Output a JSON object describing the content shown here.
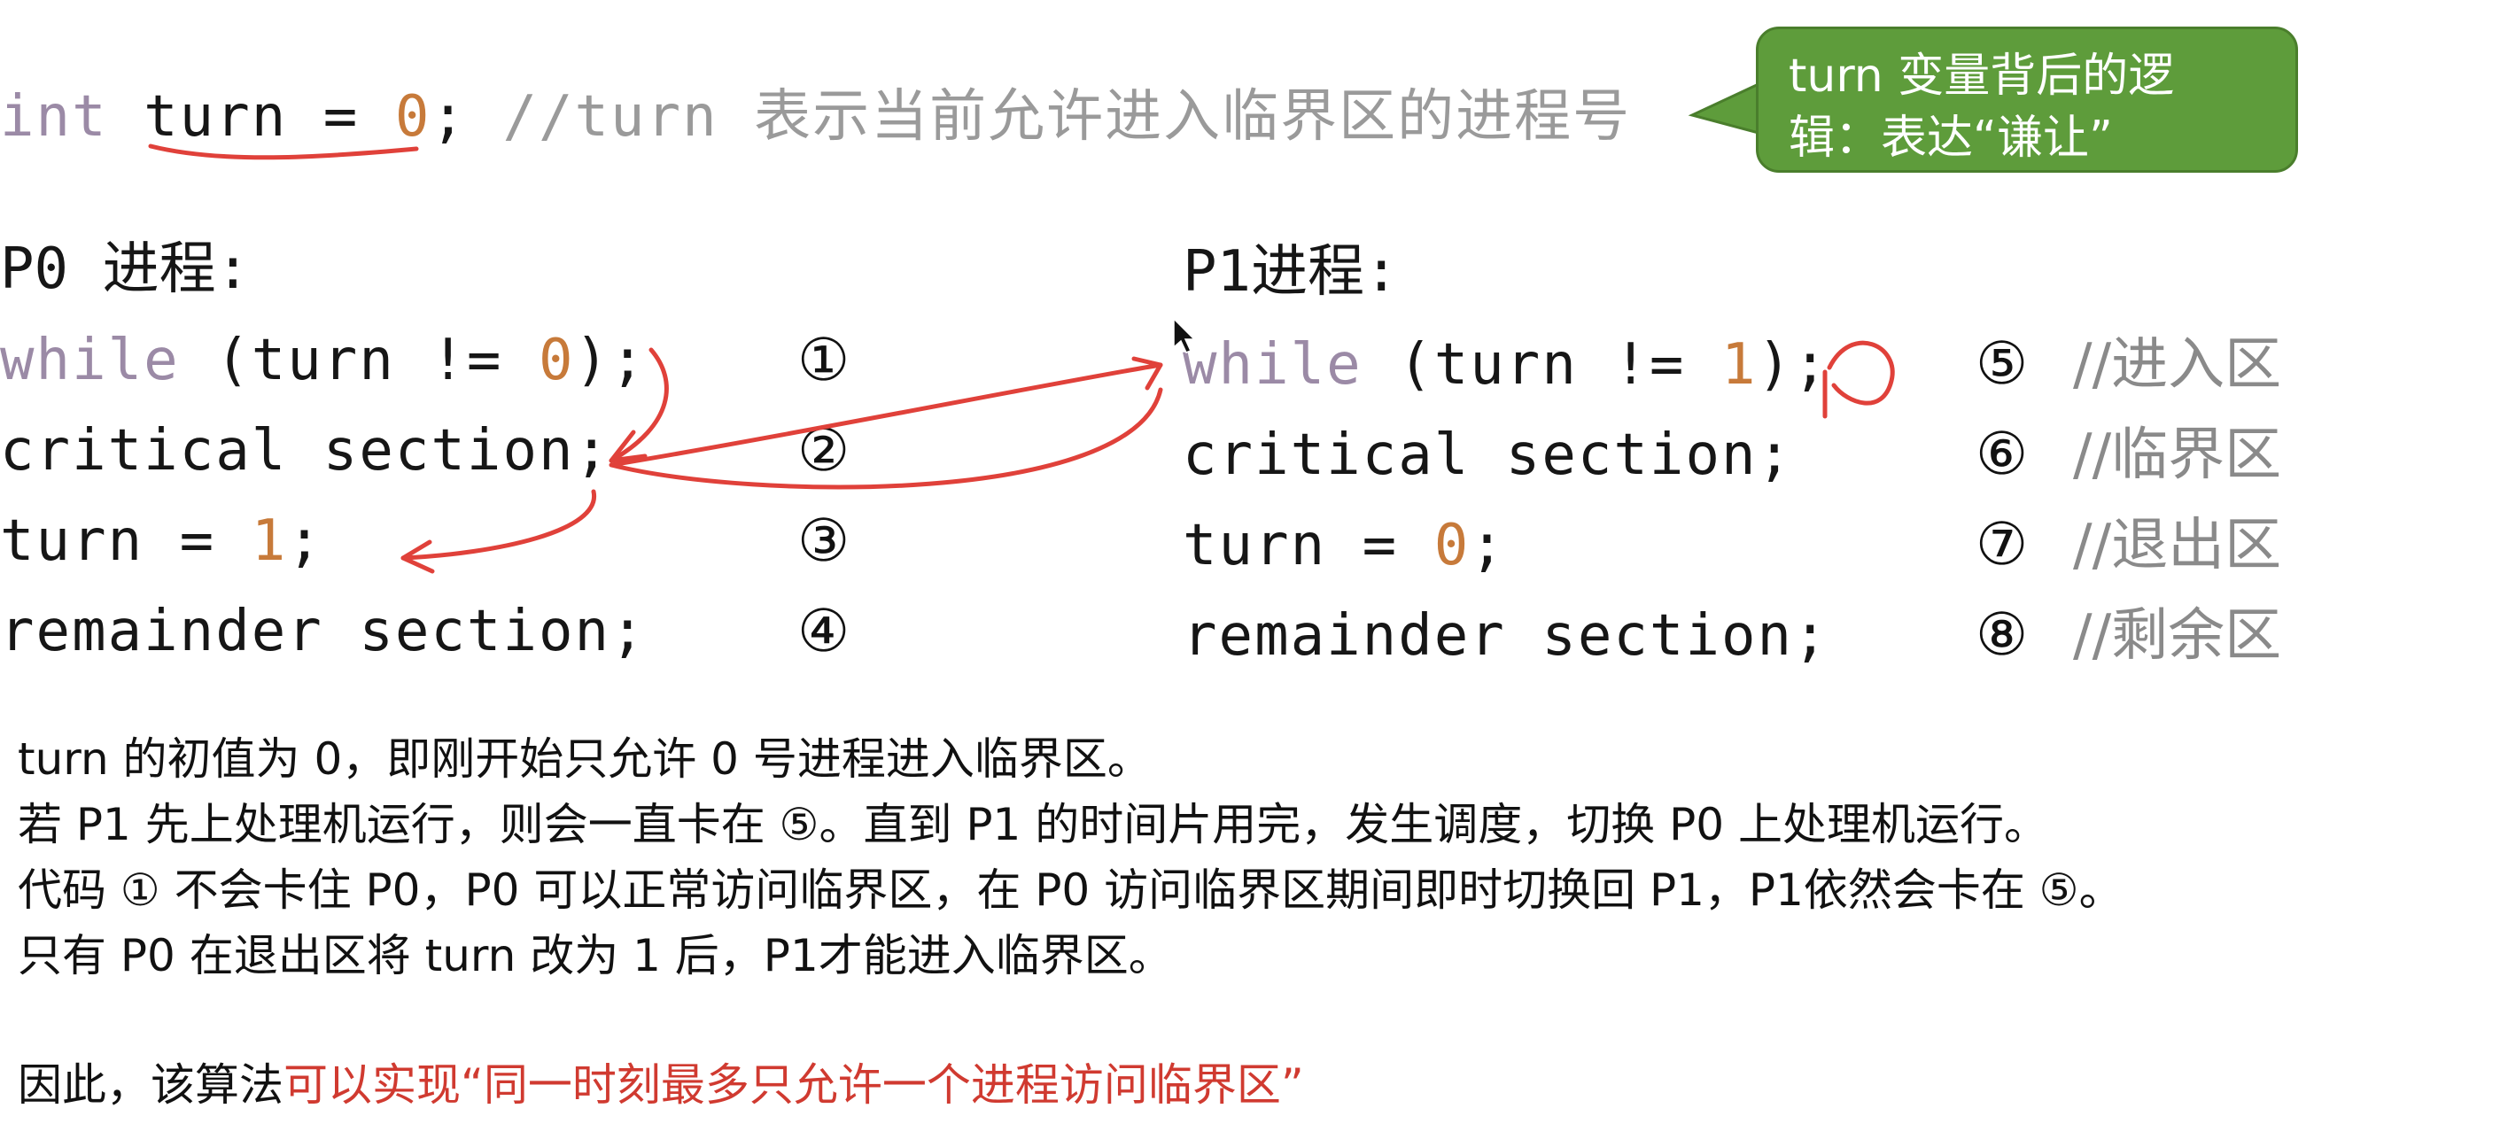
{
  "declaration": {
    "keyword": "int",
    "var": " turn = ",
    "value": "0",
    "semicolon": ";",
    "comment": " //turn 表示当前允许进入临界区的进程号"
  },
  "callout": "turn 变量背后的逻辑：表达“谦让”",
  "p0": {
    "title": "P0 进程:",
    "lines": [
      {
        "kw": "while",
        "pre": " (turn != ",
        "num": "0",
        "post": ");",
        "marker": "①"
      },
      {
        "text": "critical section;",
        "marker": "②"
      },
      {
        "pre": "turn = ",
        "num": "1",
        "post": ";",
        "marker": "③"
      },
      {
        "text": "remainder section;",
        "marker": "④"
      }
    ]
  },
  "p1": {
    "title": "P1进程:",
    "lines": [
      {
        "kw": "while",
        "pre": " (turn != ",
        "num": "1",
        "post": ");",
        "marker": "⑤",
        "comment": "//进入区"
      },
      {
        "text": "critical section;",
        "marker": "⑥",
        "comment": "//临界区"
      },
      {
        "pre": "turn = ",
        "num": "0",
        "post": ";",
        "marker": "⑦",
        "comment": "//退出区"
      },
      {
        "text": "remainder section;",
        "marker": "⑧",
        "comment": "//剩余区"
      }
    ]
  },
  "explanation": [
    "turn 的初值为 0，即刚开始只允许 0 号进程进入临界区。",
    "若 P1 先上处理机运行，则会一直卡在 ⑤。直到 P1 的时间片用完，发生调度，切换 P0 上处理机运行。",
    "代码 ① 不会卡住 P0，P0 可以正常访问临界区，在 P0 访问临界区期间即时切换回 P1，P1依然会卡在 ⑤。",
    "只有 P0 在退出区将 turn 改为 1 后，P1才能进入临界区。"
  ],
  "conclusion": {
    "prefix": "因此，该算法",
    "highlight": "可以实现“同一时刻最多只允许一个进程访问临界区”"
  },
  "colors": {
    "keyword": "#9b8aa6",
    "number": "#c77a3a",
    "comment": "#9a9a9a",
    "callout_bg": "#5e9c3b",
    "highlight": "#d03a30",
    "annotation": "#e0413a"
  }
}
